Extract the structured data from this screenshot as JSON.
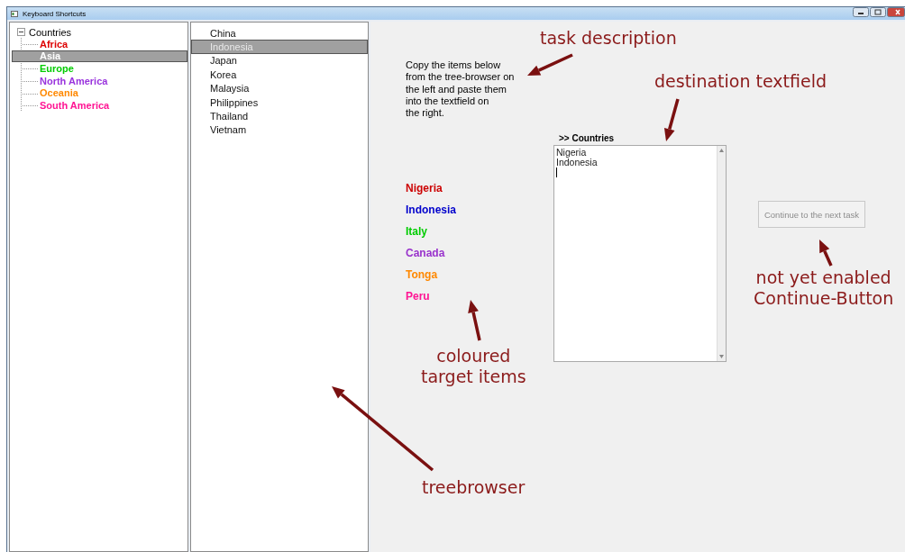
{
  "window": {
    "title": "Keyboard Shortcuts"
  },
  "tree": {
    "label": "Countries",
    "expanded": true,
    "children": [
      {
        "label": "Africa",
        "color": "#dd0000",
        "selected": false
      },
      {
        "label": "Asia",
        "selected": true
      },
      {
        "label": "Europe",
        "color": "#00cc00",
        "selected": false
      },
      {
        "label": "North America",
        "color": "#9933dd",
        "selected": false
      },
      {
        "label": "Oceania",
        "color": "#ff8800",
        "selected": false
      },
      {
        "label": "South America",
        "color": "#ff1493",
        "selected": false
      }
    ]
  },
  "list": {
    "items": [
      {
        "label": "China",
        "selected": false
      },
      {
        "label": "Indonesia",
        "selected": true
      },
      {
        "label": "Japan",
        "selected": false
      },
      {
        "label": "Korea",
        "selected": false
      },
      {
        "label": "Malaysia",
        "selected": false
      },
      {
        "label": "Philippines",
        "selected": false
      },
      {
        "label": "Thailand",
        "selected": false
      },
      {
        "label": "Vietnam",
        "selected": false
      }
    ]
  },
  "task_description": "Copy the items below\nfrom the tree-browser on\nthe left and paste them\ninto the textfield on\nthe right.",
  "targets": [
    {
      "label": "Nigeria",
      "color": "#cc0000"
    },
    {
      "label": "Indonesia",
      "color": "#0000cc"
    },
    {
      "label": "Italy",
      "color": "#00cc00"
    },
    {
      "label": "Canada",
      "color": "#9933cc"
    },
    {
      "label": "Tonga",
      "color": "#ff8800"
    },
    {
      "label": "Peru",
      "color": "#ff1493"
    }
  ],
  "destination": {
    "label": ">> Countries",
    "value": "Nigeria\nIndonesia"
  },
  "continue_button": {
    "label": "Continue to the next task",
    "disabled": true
  },
  "annotations": [
    {
      "text": "task description"
    },
    {
      "text": "destination textfield"
    },
    {
      "text": "coloured\ntarget items"
    },
    {
      "text": "not yet enabled\nContinue-Button"
    },
    {
      "text": "treebrowser"
    }
  ]
}
